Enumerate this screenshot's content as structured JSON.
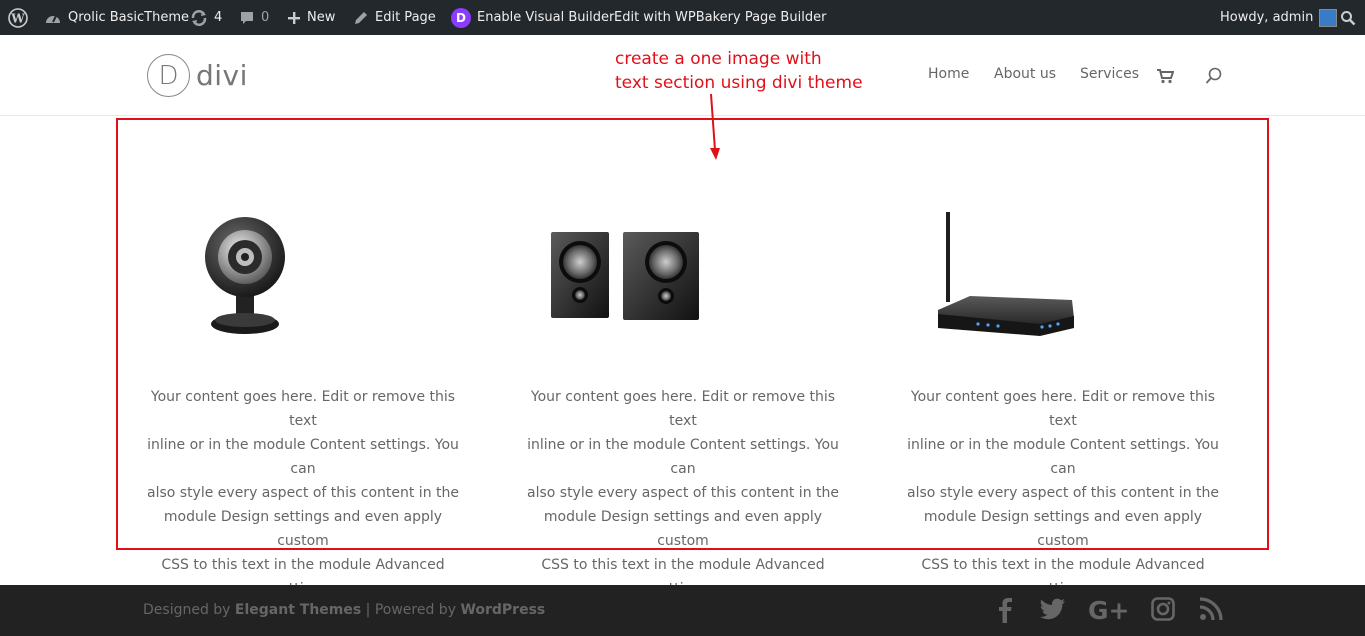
{
  "adminbar": {
    "site_name": "Qrolic BasicTheme",
    "updates_count": "4",
    "comments_count": "0",
    "new_label": "New",
    "edit_page_label": "Edit Page",
    "visual_builder_label": "Enable Visual Builder",
    "wpbakery_label": "Edit with WPBakery Page Builder",
    "howdy_label": "Howdy, admin"
  },
  "header": {
    "logo_letter": "D",
    "logo_text": "divi",
    "nav": [
      "Home",
      "About us",
      "Services"
    ]
  },
  "annotation": {
    "line1": "create a one image with",
    "line2": "text section using divi theme",
    "color": "#e0101a"
  },
  "columns": [
    {
      "image": "webcam",
      "text": [
        "Your content goes here. Edit or remove this text",
        "inline or in the module Content settings. You can",
        "also style every aspect of this content in the",
        "module Design settings and even apply custom",
        "CSS to this text in the module Advanced settings."
      ]
    },
    {
      "image": "speakers",
      "text": [
        "Your content goes here. Edit or remove this text",
        "inline or in the module Content settings. You can",
        "also style every aspect of this content in the",
        "module Design settings and even apply custom",
        "CSS to this text in the module Advanced settings."
      ]
    },
    {
      "image": "router",
      "text": [
        "Your content goes here. Edit or remove this text",
        "inline or in the module Content settings. You can",
        "also style every aspect of this content in the",
        "module Design settings and even apply custom",
        "CSS to this text in the module Advanced settings."
      ]
    }
  ],
  "footer": {
    "designed_by": "Designed by",
    "elegant": "Elegant Themes",
    "sep": "| Powered by",
    "wordpress": "WordPress"
  }
}
